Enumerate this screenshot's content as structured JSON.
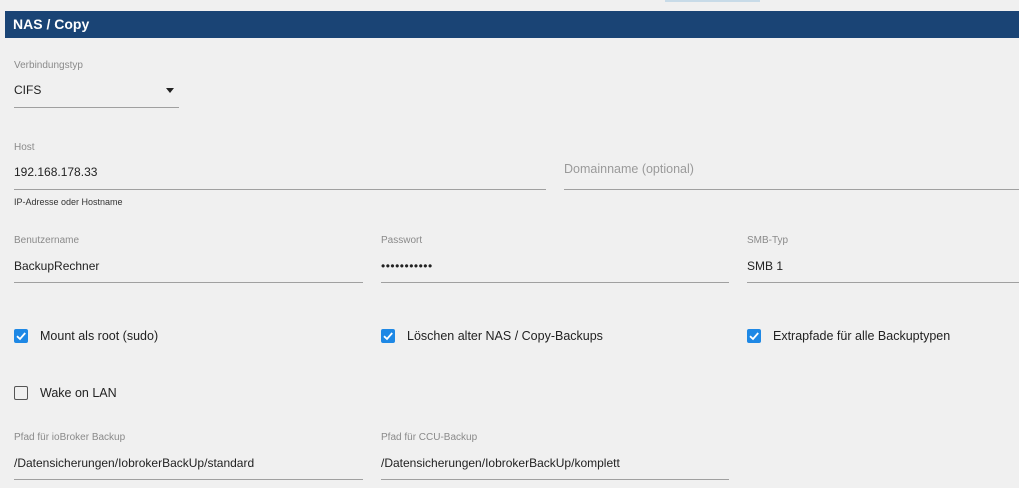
{
  "panel": {
    "title": "NAS / Copy"
  },
  "connection_type": {
    "label": "Verbindungstyp",
    "value": "CIFS"
  },
  "host": {
    "label": "Host",
    "value": "192.168.178.33",
    "helper": "IP-Adresse oder Hostname"
  },
  "domain": {
    "placeholder": "Domainname (optional)"
  },
  "username": {
    "label": "Benutzername",
    "value": "BackupRechner"
  },
  "password": {
    "label": "Passwort",
    "value": "•••••••••••"
  },
  "smb_type": {
    "label": "SMB-Typ",
    "value": "SMB 1"
  },
  "checkboxes": {
    "mount_root": {
      "label": "Mount als root (sudo)",
      "checked": true
    },
    "delete_old": {
      "label": "Löschen alter NAS / Copy-Backups",
      "checked": true
    },
    "extra_paths": {
      "label": "Extrapfade für alle Backuptypen",
      "checked": true
    },
    "wake_on_lan": {
      "label": "Wake on LAN",
      "checked": false
    }
  },
  "iobroker_path": {
    "label": "Pfad für ioBroker Backup",
    "value": "/Datensicherungen/IobrokerBackUp/standard"
  },
  "ccu_path": {
    "label": "Pfad für CCU-Backup",
    "value": "/Datensicherungen/IobrokerBackUp/komplett"
  },
  "colors": {
    "header": "#1a4475",
    "checkbox": "#1e88e5",
    "background": "#f0f0f0"
  },
  "icons": {
    "dropdown": "caret-down-icon",
    "check": "check-icon"
  }
}
